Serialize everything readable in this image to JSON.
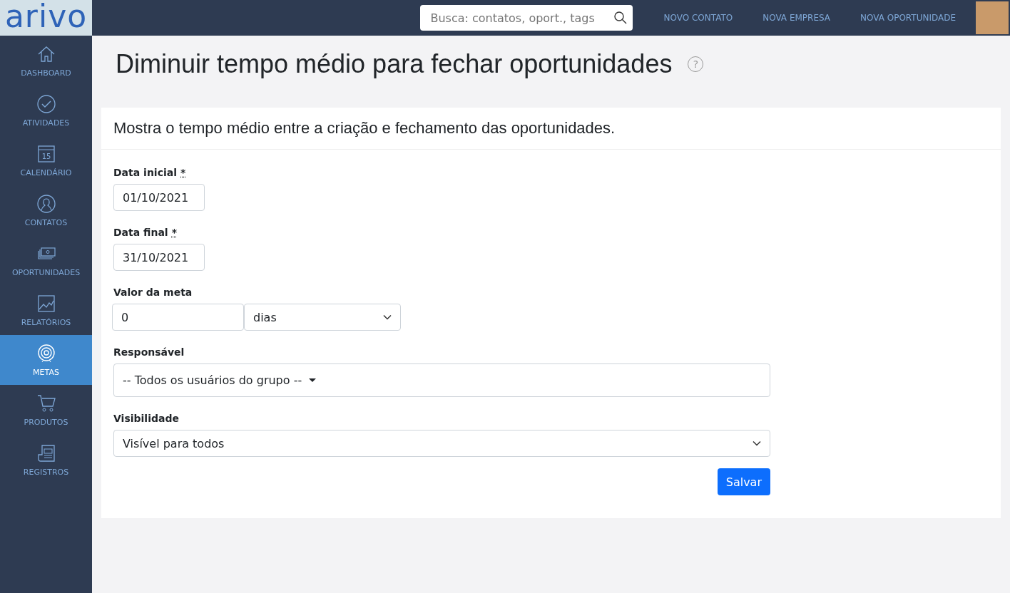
{
  "logo": "arivo",
  "sidebar": {
    "items": [
      {
        "label": "DASHBOARD",
        "kind": "home",
        "selected": false
      },
      {
        "label": "ATIVIDADES",
        "kind": "check",
        "selected": false
      },
      {
        "label": "CALENDÁRIO",
        "kind": "calendar",
        "icon_text": "15",
        "selected": false
      },
      {
        "label": "CONTATOS",
        "kind": "person",
        "selected": false
      },
      {
        "label": "OPORTUNIDADES",
        "kind": "money",
        "selected": false
      },
      {
        "label": "RELATÓRIOS",
        "kind": "chart",
        "selected": false
      },
      {
        "label": "METAS",
        "kind": "target",
        "selected": true
      },
      {
        "label": "PRODUTOS",
        "kind": "cart",
        "selected": false
      },
      {
        "label": "REGISTROS",
        "kind": "document",
        "selected": false
      }
    ]
  },
  "topbar": {
    "search": {
      "placeholder": "Busca: contatos, oport., tags"
    },
    "links": [
      "NOVO CONTATO",
      "NOVA EMPRESA",
      "NOVA OPORTUNIDADE"
    ]
  },
  "page": {
    "title": "Diminuir tempo médio para fechar oportunidades",
    "help": "?"
  },
  "card": {
    "description": "Mostra o tempo médio entre a criação e fechamento das oportunidades.",
    "fields": [
      {
        "kind": "input",
        "label": "Data inicial",
        "required": "*",
        "value": "01/10/2021"
      },
      {
        "kind": "input",
        "label": "Data final",
        "required": "*",
        "value": "31/10/2021"
      },
      {
        "kind": "input_select",
        "label": "Valor da meta",
        "value": "0",
        "unit": "dias"
      },
      {
        "kind": "dropdown",
        "label": "Responsável",
        "value": "-- Todos os usuários do grupo --"
      },
      {
        "kind": "select",
        "label": "Visibilidade",
        "value": "Visível para todos"
      }
    ],
    "submit": "Salvar"
  }
}
